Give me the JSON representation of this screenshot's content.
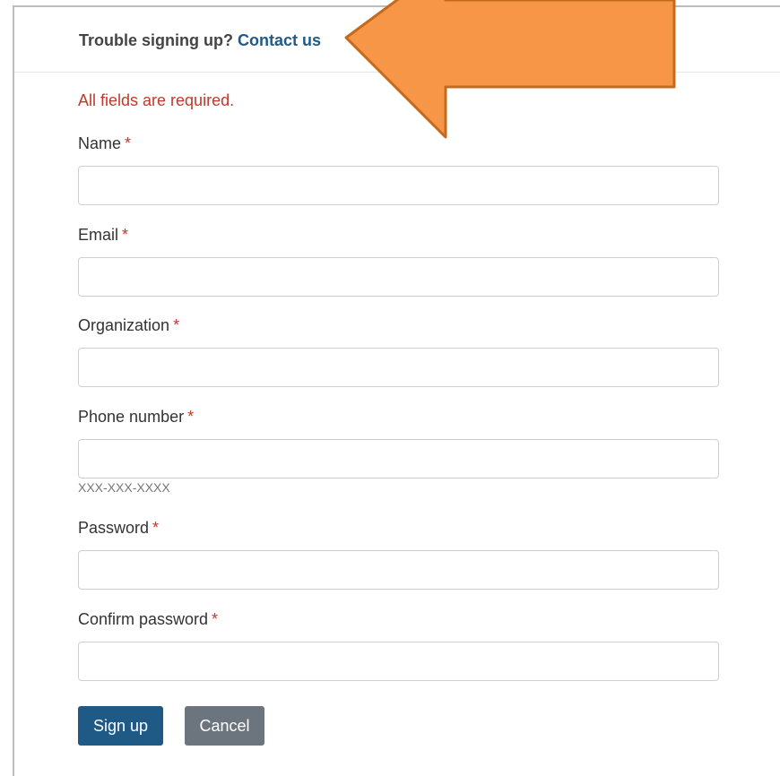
{
  "header": {
    "trouble_text": "Trouble signing up?",
    "contact_link": "Contact us"
  },
  "form": {
    "required_note": "All fields are required.",
    "required_marker": "*",
    "fields": [
      {
        "label": "Name",
        "value": ""
      },
      {
        "label": "Email",
        "value": ""
      },
      {
        "label": "Organization",
        "value": ""
      },
      {
        "label": "Phone number",
        "value": "",
        "help": "XXX-XXX-XXXX"
      },
      {
        "label": "Password",
        "value": ""
      },
      {
        "label": "Confirm password",
        "value": ""
      }
    ],
    "submit_label": "Sign up",
    "cancel_label": "Cancel"
  },
  "annotation": {
    "arrow_color": "#f79646",
    "arrow_stroke": "#c46a1c",
    "arrow_icon": "orange-callout-arrow"
  },
  "colors": {
    "primary": "#1f5a87",
    "secondary": "#6c757d",
    "required": "#c0392b"
  }
}
